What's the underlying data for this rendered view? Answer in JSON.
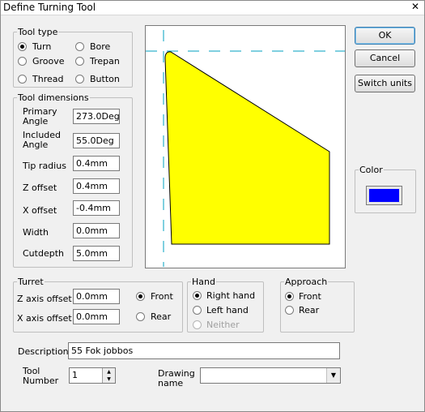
{
  "window": {
    "title": "Define Turning Tool",
    "close_glyph": "✕"
  },
  "tool_type": {
    "legend": "Tool type",
    "options": [
      {
        "label": "Turn",
        "checked": true
      },
      {
        "label": "Bore",
        "checked": false
      },
      {
        "label": "Groove",
        "checked": false
      },
      {
        "label": "Trepan",
        "checked": false
      },
      {
        "label": "Thread",
        "checked": false
      },
      {
        "label": "Button",
        "checked": false
      }
    ]
  },
  "tool_dimensions": {
    "legend": "Tool dimensions",
    "fields": [
      {
        "label": "Primary\nAngle",
        "value": "273.0Deg"
      },
      {
        "label": "Included\nAngle",
        "value": "55.0Deg"
      },
      {
        "label": "Tip radius",
        "value": "0.4mm"
      },
      {
        "label": "Z offset",
        "value": "0.4mm"
      },
      {
        "label": "X offset",
        "value": "-0.4mm"
      },
      {
        "label": "Width",
        "value": "0.0mm"
      },
      {
        "label": "Cutdepth",
        "value": "5.0mm"
      }
    ]
  },
  "buttons": {
    "ok": "OK",
    "cancel": "Cancel",
    "switch_units": "Switch units"
  },
  "color": {
    "legend": "Color",
    "swatch": "#0000ff"
  },
  "preview": {
    "insert_fill": "#ffff00",
    "guide_color": "#00a0c0"
  },
  "turret": {
    "legend": "Turret",
    "z_label": "Z axis offset",
    "z_value": "0.0mm",
    "x_label": "X axis offset",
    "x_value": "0.0mm",
    "front": "Front",
    "rear": "Rear"
  },
  "hand": {
    "legend": "Hand",
    "right": "Right hand",
    "left": "Left hand",
    "neither": "Neither"
  },
  "approach": {
    "legend": "Approach",
    "front": "Front",
    "rear": "Rear"
  },
  "description": {
    "label": "Description",
    "value": "55 Fok jobbos"
  },
  "tool_number": {
    "label": "Tool\nNumber",
    "value": "1"
  },
  "drawing_name": {
    "label": "Drawing\nname",
    "value": ""
  }
}
